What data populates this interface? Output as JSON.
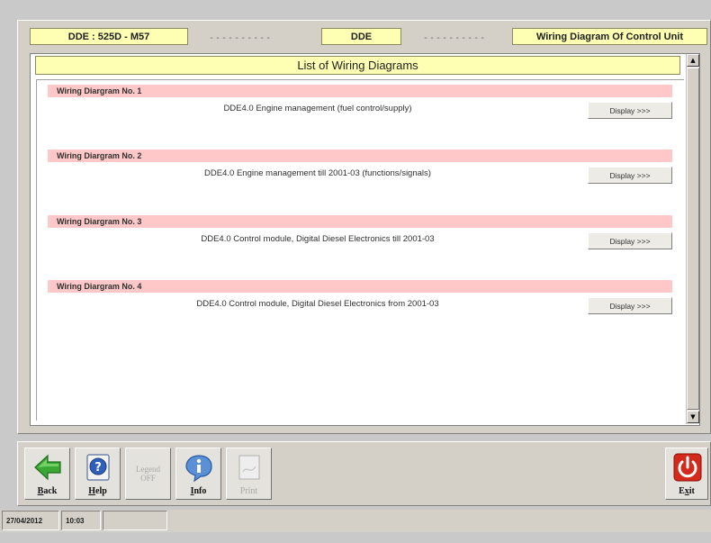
{
  "header": {
    "vehicle": "DDE : 525D - M57",
    "separator_left": "----------",
    "module": "DDE",
    "separator_right": "----------",
    "function": "Wiring Diagram Of Control Unit"
  },
  "list": {
    "title": "List of Wiring Diagrams",
    "items": [
      {
        "header": "Wiring Diargram No.  1",
        "description": "DDE4.0 Engine management (fuel control/supply)",
        "button": "Display >>>"
      },
      {
        "header": "Wiring Diargram No.  2",
        "description": "DDE4.0 Engine management till 2001-03 (functions/signals)",
        "button": "Display >>>"
      },
      {
        "header": "Wiring Diargram No.  3",
        "description": "DDE4.0 Control module, Digital Diesel Electronics till 2001-03",
        "button": "Display >>>"
      },
      {
        "header": "Wiring Diargram No.  4",
        "description": "DDE4.0 Control module, Digital Diesel Electronics from 2001-03",
        "button": "Display >>>"
      }
    ]
  },
  "toolbar": {
    "back": "Back",
    "help": "Help",
    "legend_line1": "Legend",
    "legend_line2": "OFF",
    "info": "Info",
    "print": "Print",
    "exit": "Exit"
  },
  "status": {
    "date": "27/04/2012",
    "time": "10:03"
  },
  "colors": {
    "header_fill": "#ffffb4",
    "item_header_fill": "#ffc8c8",
    "exit_red": "#d42a1c",
    "back_green": "#3aa835"
  }
}
